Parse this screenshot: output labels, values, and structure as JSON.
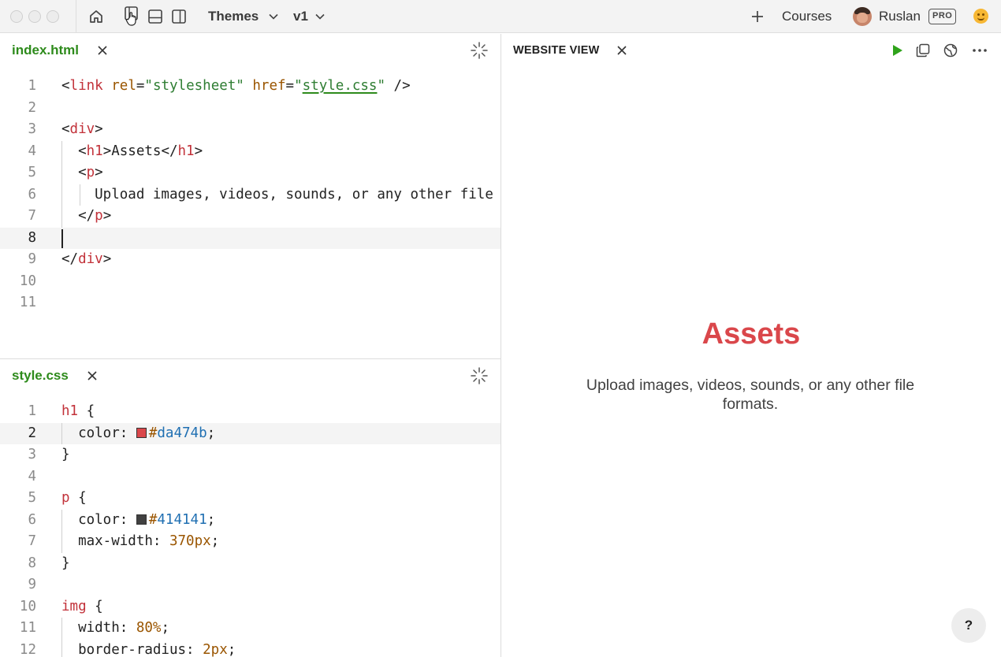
{
  "toolbar": {
    "themes_label": "Themes",
    "version_label": "v1",
    "courses_label": "Courses",
    "user_name": "Ruslan",
    "plan_badge": "PRO",
    "icons": [
      "home-icon",
      "layout-single-icon",
      "layout-stacked-icon",
      "layout-columns-icon",
      "plus-icon"
    ]
  },
  "html_editor": {
    "filename": "index.html",
    "active_line": 8
  },
  "css_editor": {
    "filename": "style.css",
    "active_line": 2,
    "swatches": {
      "h1_color": "#da474b",
      "p_color": "#414141"
    }
  },
  "website_view": {
    "title": "WEBSITE VIEW",
    "heading": "Assets",
    "paragraph": "Upload images, videos, sounds, or any other file formats.",
    "help_label": "?"
  },
  "colors": {
    "accent_green": "#2e8b1c",
    "heading_red": "#da474b",
    "paragraph_gray": "#414141",
    "run_green": "#2fa31b"
  }
}
